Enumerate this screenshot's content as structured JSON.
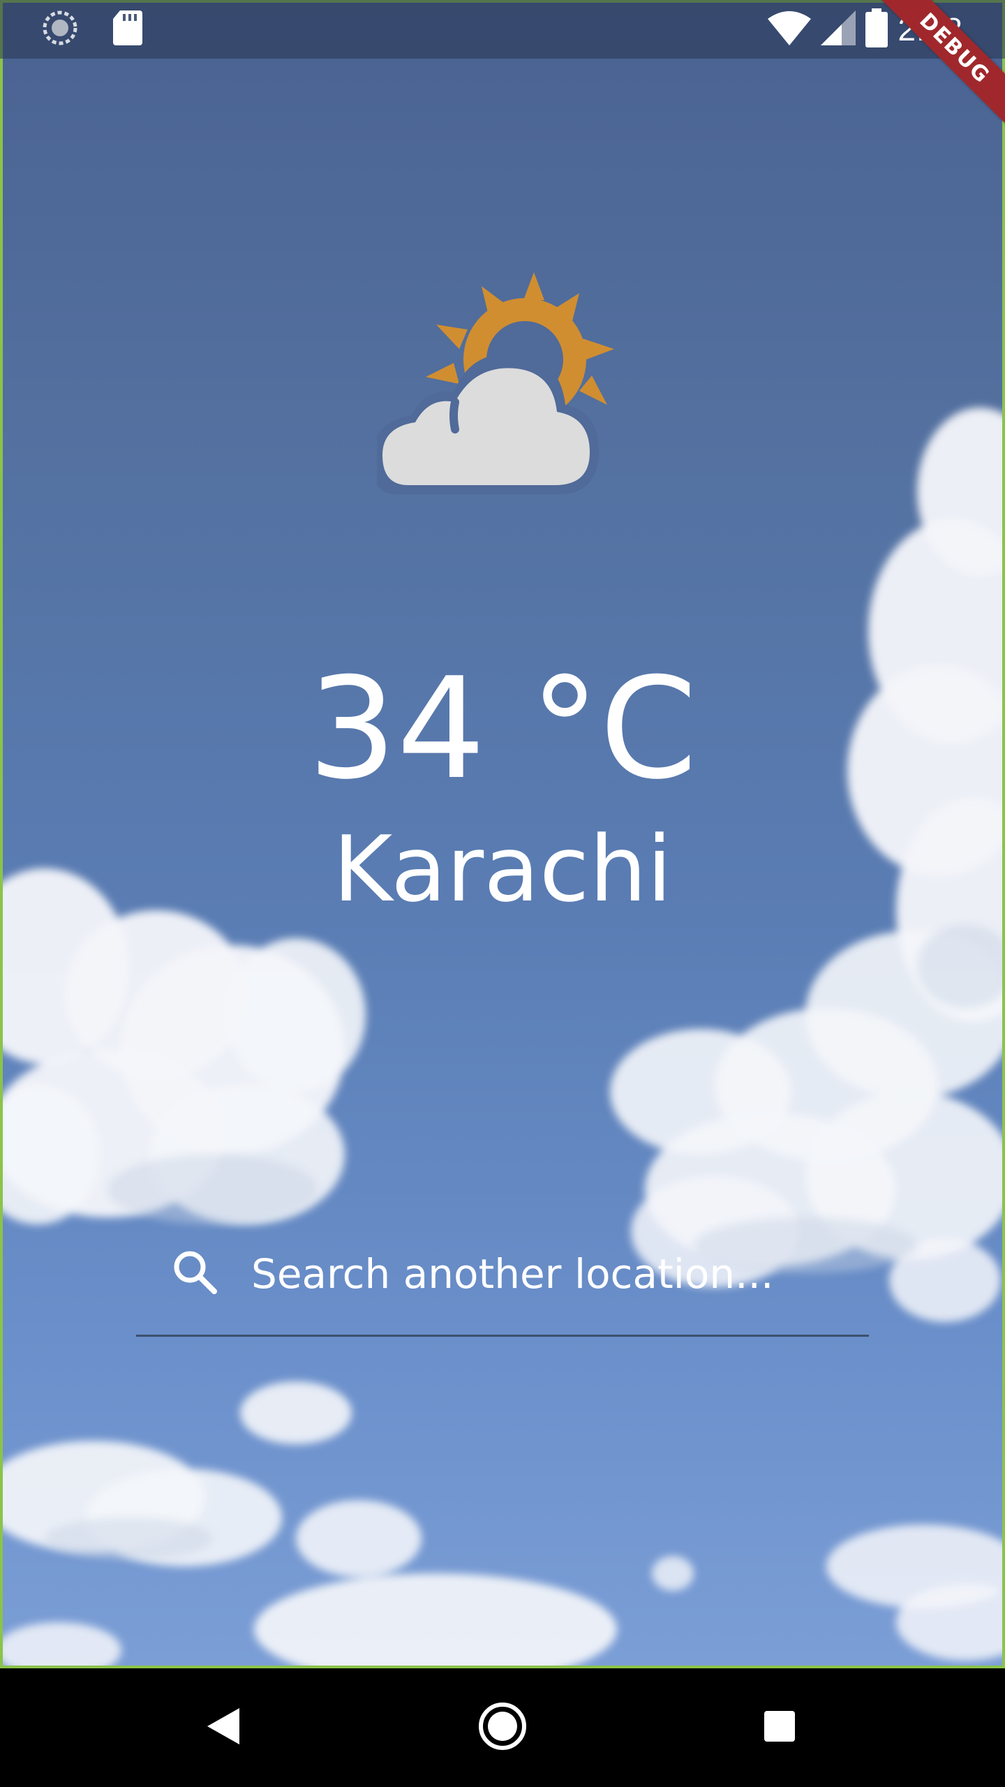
{
  "status_bar": {
    "time": "2:48",
    "left_icons": [
      "loading-circle-icon",
      "sd-card-icon"
    ],
    "right_icons": [
      "wifi-icon",
      "cellular-signal-icon",
      "battery-icon"
    ]
  },
  "debug_banner": {
    "label": "DEBUG",
    "color": "#a0282c"
  },
  "weather": {
    "icon": "partly-cloudy-icon",
    "temperature": "34 °C",
    "city": "Karachi",
    "sun_color": "#d08e30",
    "cloud_color": "#dcdcdc"
  },
  "search": {
    "icon": "search-icon",
    "placeholder": "Search another location..."
  },
  "nav_bar": {
    "buttons": [
      "back-icon",
      "home-icon",
      "recents-icon"
    ]
  },
  "colors": {
    "sky_top": "#4a6291",
    "sky_bottom": "#7b9ed6",
    "frame": "#8bc34a"
  }
}
